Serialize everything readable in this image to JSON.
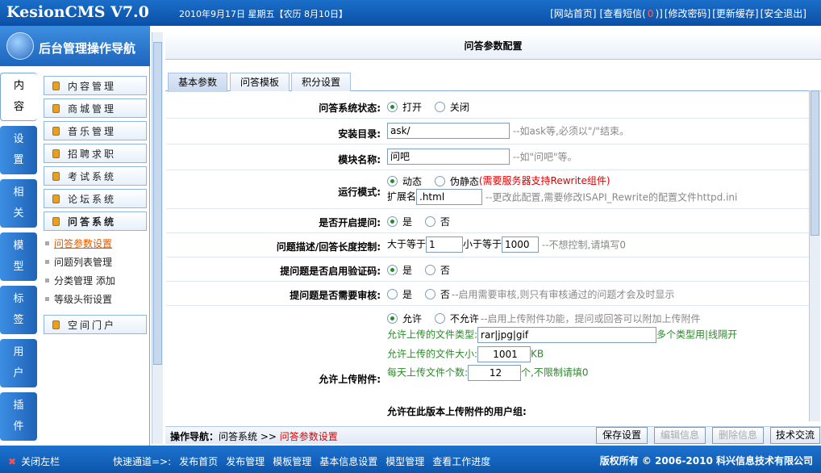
{
  "header": {
    "logo": "KesionCMS V7.0",
    "date": "2010年9月17日 星期五【农历 8月10日】",
    "links": [
      "[网站首页]",
      "[查看短信(",
      "0",
      ")]",
      "[修改密码]",
      "[更新缓存]",
      "[安全退出]"
    ]
  },
  "sidebar": {
    "title": "后台管理操作导航",
    "vtabs": [
      "内容",
      "设置",
      "相关",
      "模型",
      "标签",
      "用户",
      "插件"
    ],
    "menus": [
      "内容管理",
      "商城管理",
      "音乐管理",
      "招聘求职",
      "考试系统",
      "论坛系统",
      "问答系统"
    ],
    "subitems": [
      "问答参数设置",
      "问题列表管理",
      "分类管理 添加",
      "等级头衔设置"
    ],
    "extra_menu": "空间门户"
  },
  "main": {
    "title": "问答参数配置",
    "tabs": [
      "基本参数",
      "问答模板",
      "积分设置"
    ],
    "fields": {
      "status_label": "问答系统状态:",
      "status_on": "打开",
      "status_off": "关闭",
      "dir_label": "安装目录:",
      "dir_value": "ask/",
      "dir_hint": "--如ask等,必须以\"/\"结束。",
      "name_label": "模块名称:",
      "name_value": "问吧",
      "name_hint": "--如\"问吧\"等。",
      "mode_label": "运行模式:",
      "mode_dynamic": "动态",
      "mode_static": "伪静态",
      "mode_note": "(需要服务器支持Rewrite组件)",
      "ext_label": "扩展名",
      "ext_value": ".html",
      "ext_hint": "--更改此配置,需要修改ISAPI_Rewrite的配置文件httpd.ini",
      "ask_label": "是否开启提问:",
      "yes": "是",
      "no": "否",
      "len_label": "问题描述/回答长度控制:",
      "len_gte": "大于等于",
      "len_min": "1",
      "len_lte": "小于等于",
      "len_max": "1000",
      "len_hint": "--不想控制,请填写0",
      "captcha_label": "提问题是否启用验证码:",
      "audit_label": "提问题是否需要审核:",
      "audit_hint": "--启用需要审核,则只有审核通过的问题才会及时显示",
      "upload_label": "允许上传附件:",
      "upload_allow": "允许",
      "upload_deny": "不允许",
      "upload_hint": "--启用上传附件功能，提问或回答可以附加上传附件",
      "types_label": "允许上传的文件类型:",
      "types_value": "rar|jpg|gif",
      "types_hint": "多个类型用|线隔开",
      "size_label": "允许上传的文件大小:",
      "size_value": "1001",
      "size_unit": "KB",
      "daily_label": "每天上传文件个数:",
      "daily_value": "12",
      "daily_hint": "个,不限制请填0",
      "groups_label": "允许在此版本上传附件的用户组:"
    }
  },
  "bottom": {
    "crumb_prefix": "操作导航：",
    "crumb_sys": "问答系统",
    "crumb_sep": ">>",
    "crumb_cur": "问答参数设置",
    "buttons": [
      "保存设置",
      "编辑信息",
      "删除信息",
      "技术交流"
    ]
  },
  "footer": {
    "close": "关闭左栏",
    "quick_label": "快速通道=>:",
    "quick_links": [
      "发布首页",
      "发布管理",
      "模板管理",
      "基本信息设置",
      "模型管理",
      "查看工作进度"
    ],
    "copyright": "版权所有 © 2006-2010 科兴信息技术有限公司"
  },
  "colors": {
    "accent": "#1a6fc9",
    "hint_red": "#dd0000",
    "hint_green": "#2a8a2a",
    "current_orange": "#e05a00"
  }
}
